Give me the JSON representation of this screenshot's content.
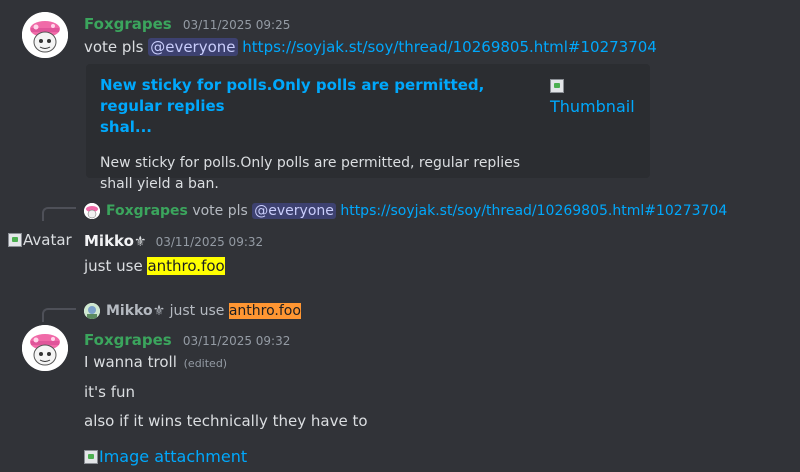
{
  "messages": [
    {
      "username": "Foxgrapes",
      "timestamp": "03/11/2025 09:25",
      "text_before": "vote pls ",
      "mention": "@everyone",
      "link": "https://soyjak.st/soy/thread/10269805.html#10273704",
      "embed": {
        "title_line1": "New sticky for polls.Only polls are permitted, regular replies",
        "title_line2": "shal...",
        "desc_line1": "New sticky for polls.Only polls are permitted, regular replies",
        "desc_line2": "shall yield a ban.",
        "thumbnail_alt": "Thumbnail"
      }
    },
    {
      "reply": {
        "username": "Foxgrapes",
        "text_before": "vote pls ",
        "mention": "@everyone",
        "link": "https://soyjak.st/soy/thread/10269805.html#10273704"
      },
      "avatar_alt": "Avatar",
      "username": "Mikko",
      "badge": "⚜",
      "timestamp": "03/11/2025 09:32",
      "text_before": "just use ",
      "highlight": "anthro.foo"
    },
    {
      "reply": {
        "username": "Mikko",
        "badge": "⚜",
        "text_before": "just use ",
        "highlight": "anthro.foo"
      },
      "username": "Foxgrapes",
      "timestamp": "03/11/2025 09:32",
      "lines": [
        "I wanna troll",
        "it's fun",
        "also if it wins technically they have to"
      ],
      "edited": "(edited)",
      "image_alt": "Image attachment"
    }
  ],
  "colors": {
    "background": "#313338",
    "username_green": "#3ba55d",
    "link": "#00a8fc",
    "highlight_yellow": "#ffff00",
    "highlight_orange": "#ff9632"
  }
}
